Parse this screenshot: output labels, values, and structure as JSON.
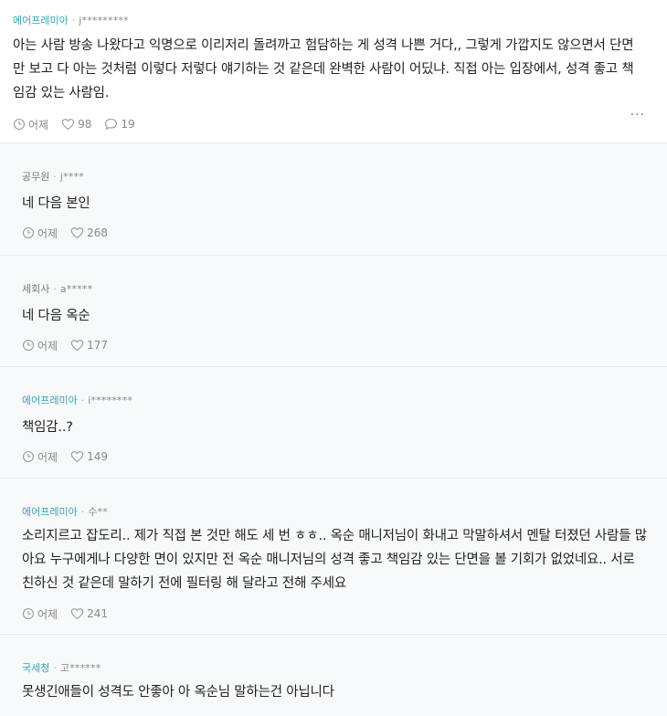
{
  "post": {
    "company": "에어프레미아",
    "user": "j*********",
    "text": "아는 사람 방송 나왔다고 익명으로 이리저리 돌려까고 험담하는 게 성격 나쁜 거다,, 그렇게 가깝지도 않으면서 단면만 보고 다 아는 것처럼 이렇다 저렇다 얘기하는 것 같은데 완벽한 사람이 어딨냐. 직접 아는 입장에서, 성격 좋고 책임감 있는 사람임.",
    "time": "어제",
    "likes": "98",
    "comments": "19",
    "more": "···"
  },
  "comments": [
    {
      "company": "공무원",
      "user": "j****",
      "text": "네 다음 본인",
      "time": "어제",
      "likes": "268"
    },
    {
      "company": "세회사",
      "user": "a*****",
      "text": "네 다음 옥순",
      "time": "어제",
      "likes": "177"
    },
    {
      "company": "에어프레미아",
      "user": "i********",
      "text": "책임감..?",
      "time": "어제",
      "likes": "149"
    },
    {
      "company": "에어프레미아",
      "user": "수**",
      "text": "소리지르고 잡도리.. 제가 직접 본 것만 해도 세 번 ㅎㅎ.. 옥순 매니저님이 화내고 막말하셔서 멘탈 터졌던 사람들 많아요 누구에게나 다양한 면이 있지만 전 옥순 매니저님의 성격 좋고 책임감 있는 단면을 볼 기회가 없었네요.. 서로 친하신 것 같은데 말하기 전에 필터링 해 달라고 전해 주세요",
      "time": "어제",
      "likes": "241"
    },
    {
      "company": "국세청",
      "user": "고******",
      "text": "못생긴애들이 성격도 안좋아 아 옥순님 말하는건 아닙니다"
    }
  ]
}
